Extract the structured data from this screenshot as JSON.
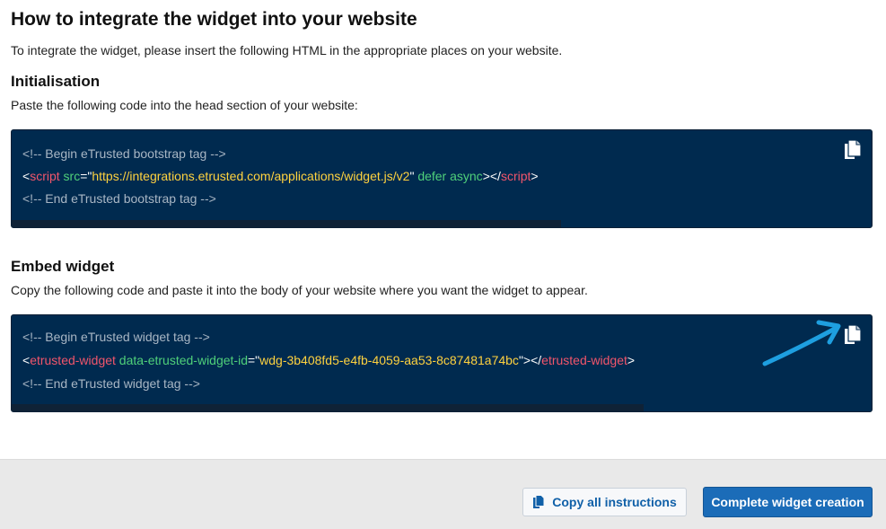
{
  "page": {
    "title": "How to integrate the widget into your website",
    "intro": "To integrate the widget, please insert the following HTML in the appropriate places on your website."
  },
  "init": {
    "heading": "Initialisation",
    "description": "Paste the following code into the head section of your website:",
    "code": {
      "comment_begin": "<!-- Begin eTrusted bootstrap tag -->",
      "lt": "<",
      "tag": "script",
      "sp1": " ",
      "attr_src": "src",
      "eq_q": "=\"",
      "src_value": "https://integrations.etrusted.com/applications/widget.js/v2",
      "q": "\"",
      "sp2": " ",
      "attr_defer": "defer async",
      "gt_close": "></",
      "gt": ">",
      "comment_end": "<!-- End eTrusted bootstrap tag -->"
    },
    "copy_icon": "copy-icon"
  },
  "embed": {
    "heading": "Embed widget",
    "description": "Copy the following code and paste it into the body of your website where you want the widget to appear.",
    "code": {
      "comment_begin": "<!-- Begin eTrusted widget tag -->",
      "lt": "<",
      "tag": "etrusted-widget",
      "sp1": " ",
      "attr_id": "data-etrusted-widget-id",
      "eq_q": "=\"",
      "id_value": "wdg-3b408fd5-e4fb-4059-aa53-8c87481a74bc",
      "q_gt_close": "\"></",
      "gt": ">",
      "comment_end": "<!-- End eTrusted widget tag -->"
    },
    "copy_icon": "copy-icon"
  },
  "footer": {
    "copy_all_label": "Copy all instructions",
    "complete_label": "Complete widget creation"
  },
  "colors": {
    "code_bg": "#002a4f",
    "tag": "#f2556b",
    "attr": "#4fd07a",
    "string": "#ffd23f",
    "arrow": "#1e9fe0",
    "primary": "#1b6cb8"
  }
}
